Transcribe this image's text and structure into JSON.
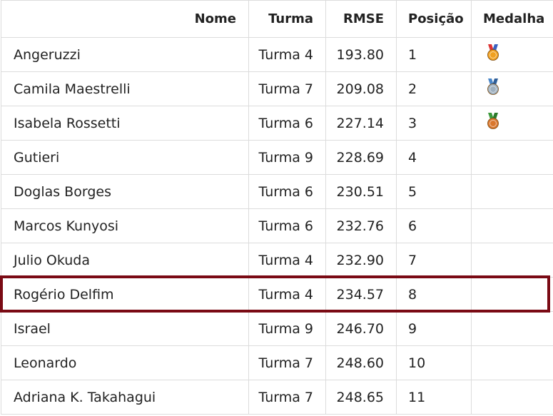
{
  "headers": {
    "nome": "Nome",
    "turma": "Turma",
    "rmse": "RMSE",
    "posicao": "Posição",
    "medalha": "Medalha"
  },
  "rows": [
    {
      "nome": "Angeruzzi",
      "turma": "Turma 4",
      "rmse": "193.80",
      "posicao": "1",
      "medal": "gold-medal-icon"
    },
    {
      "nome": "Camila Maestrelli",
      "turma": "Turma 7",
      "rmse": "209.08",
      "posicao": "2",
      "medal": "silver-medal-icon"
    },
    {
      "nome": "Isabela Rossetti",
      "turma": "Turma 6",
      "rmse": "227.14",
      "posicao": "3",
      "medal": "bronze-medal-icon"
    },
    {
      "nome": "Gutieri",
      "turma": "Turma 9",
      "rmse": "228.69",
      "posicao": "4",
      "medal": ""
    },
    {
      "nome": "Doglas Borges",
      "turma": "Turma 6",
      "rmse": "230.51",
      "posicao": "5",
      "medal": ""
    },
    {
      "nome": "Marcos Kunyosi",
      "turma": "Turma 6",
      "rmse": "232.76",
      "posicao": "6",
      "medal": ""
    },
    {
      "nome": "Julio Okuda",
      "turma": "Turma 4",
      "rmse": "232.90",
      "posicao": "7",
      "medal": ""
    },
    {
      "nome": "Rogério Delfim",
      "turma": "Turma 4",
      "rmse": "234.57",
      "posicao": "8",
      "medal": ""
    },
    {
      "nome": "Israel",
      "turma": "Turma 9",
      "rmse": "246.70",
      "posicao": "9",
      "medal": ""
    },
    {
      "nome": "Leonardo",
      "turma": "Turma 7",
      "rmse": "248.60",
      "posicao": "10",
      "medal": ""
    },
    {
      "nome": "Adriana K. Takahagui",
      "turma": "Turma 7",
      "rmse": "248.65",
      "posicao": "11",
      "medal": ""
    }
  ],
  "highlighted_row": "Rogério Delfim",
  "colors": {
    "highlight_border": "#7a0a14",
    "grid": "#dcdcdc",
    "gold": "#f0a020",
    "silver": "#9fb0bf",
    "bronze": "#d9772e"
  }
}
